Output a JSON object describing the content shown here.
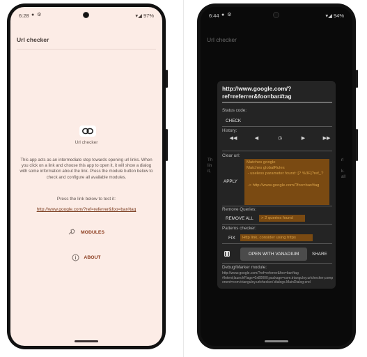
{
  "left_phone": {
    "status": {
      "time": "6:28",
      "icons": "● ⚙",
      "right": "▾◢ 97%"
    },
    "app_title": "Url checker",
    "logo_label": "Url checker",
    "description": "This app acts as an intermediate step towards opening url links. When you click on a link and choose this app to open it, it will show a dialog with some information about the link. Press the module button below to check and configure all available modules.",
    "press_text": "Press the link below to test it:",
    "test_link": "http://www.google.com/?ref=referrer&foo=bar#tag",
    "modules_label": "MODULES",
    "about_label": "ABOUT"
  },
  "right_phone": {
    "status": {
      "time": "6:44",
      "icons": "● ⚙",
      "right": "▾◢ 94%"
    },
    "app_title": "Url checker",
    "dialog": {
      "url": "http://www.google.com/?ref=referrer&foo=bar#tag",
      "status_label": "Status code:",
      "check_label": "CHECK",
      "history_label": "History:",
      "history_buttons": [
        "◀◀",
        "◀",
        "◷",
        "▶",
        "▶▶"
      ],
      "clear_label": "Clear url:",
      "apply_label": "APPLY",
      "clear_text": "Matches google\nMatches globalRules\n - useless parameter found: [? %3F]?ref_?\n\n -> http://www.google.com/?foo=bar#tag",
      "remove_label": "Remove Queries:",
      "remove_all_label": "REMOVE ALL",
      "queries_found": "> 2 queries found",
      "patterns_label": "Patterns checker:",
      "fix_label": "FIX",
      "pattern_warning": "Http link, consider using https",
      "open_label": "OPEN WITH VANADIUM",
      "share_label": "SHARE",
      "debug_label": "Debug/Marker module:",
      "debug_text": "http://www.google.com/?ref=referrer&foo=bar#tag\n#Intent;launchFlags=0x80000;package=com.trianguloy.urlchecker;component=com.trianguloy.urlchecker/.dialogs.MainDialog;end"
    }
  },
  "colors": {
    "left_bg": "#fcece6",
    "accent": "#8a3a1c",
    "right_bg": "#0a0a0a",
    "dialog_bg": "#242424",
    "highlight_bg": "#7a4a12",
    "highlight_text": "#d9a34a"
  },
  "icons": {
    "logo": "link-icon",
    "modules": "puzzle-icon",
    "about": "info-icon",
    "open_app": "browser-icon"
  }
}
